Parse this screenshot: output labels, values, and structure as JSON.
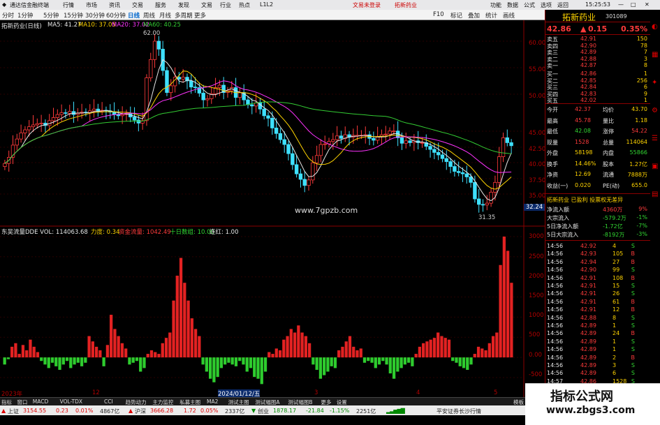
{
  "titlebar": {
    "app_name": "通达信金融终端",
    "menus": [
      "行情",
      "市场",
      "资讯",
      "交易",
      "服务",
      "发现",
      "文易",
      "行业",
      "热点",
      "L1L2"
    ],
    "right_items": [
      "文易未登录",
      "拓新药业"
    ],
    "controls": [
      "功能",
      "数据",
      "公式",
      "选项",
      "返回"
    ],
    "time": "15:25:53"
  },
  "toolbar": {
    "periods": [
      "分时",
      "1分钟",
      "5分钟",
      "15分钟",
      "30分钟",
      "60分钟",
      "日线",
      "周线",
      "月线",
      "多周期",
      "更多"
    ],
    "active": "日线",
    "right_labels": [
      "F10",
      "标记",
      "叠加",
      "统计",
      "画线"
    ]
  },
  "chart": {
    "title": "拓新药业(日线)",
    "ma_legend": [
      {
        "label": "MA5: 41.27",
        "color": "#e6e6e6"
      },
      {
        "label": "MA10: 37.05",
        "color": "#ffd400"
      },
      {
        "label": "MA20: 37.02",
        "color": "#ff33ff"
      },
      {
        "label": "MA60: 40.25",
        "color": "#33cc33"
      }
    ],
    "high_label": "62.00",
    "low_label": "31.35",
    "price_axis": [
      "60.00",
      "55.00",
      "50.00",
      "45.00",
      "42.50",
      "40.00",
      "37.50",
      "35.00"
    ],
    "crosshair_price": "32.24",
    "site": "www.7gpzb.com",
    "indicator_legend": [
      {
        "label": "东吴流量DDE  VOL: 114063.68",
        "color": "#e6e6e6"
      },
      {
        "label": "力度: 0.34",
        "color": "#ffd400"
      },
      {
        "label": "资金流量: 1042.49",
        "color": "#ff3b3b"
      },
      {
        "label": "十日数组: 10.00",
        "color": "#32d732"
      },
      {
        "label": "连红: 1.00",
        "color": "#e6e6e6"
      }
    ],
    "volume_axis": [
      "3000",
      "2500",
      "2000",
      "1500",
      "1000",
      "500",
      "0.00",
      "-500"
    ],
    "x_labels": [
      "2023年",
      "12",
      "2024/01/12/五",
      "3",
      "4",
      "5"
    ]
  },
  "quote": {
    "name": "拓新药业",
    "code": "301089",
    "price": "42.86",
    "change": "0.15",
    "change_pct": "0.35%",
    "asks": [
      {
        "label": "卖五",
        "price": "42.91",
        "vol": "150"
      },
      {
        "label": "卖四",
        "price": "42.90",
        "vol": "78"
      },
      {
        "label": "卖三",
        "price": "42.89",
        "vol": "7"
      },
      {
        "label": "卖二",
        "price": "42.88",
        "vol": "3"
      },
      {
        "label": "卖一",
        "price": "42.87",
        "vol": "8"
      }
    ],
    "bids": [
      {
        "label": "买一",
        "price": "42.86",
        "vol": "1"
      },
      {
        "label": "买二",
        "price": "42.85",
        "vol": "256"
      },
      {
        "label": "买三",
        "price": "42.84",
        "vol": "6"
      },
      {
        "label": "买四",
        "price": "42.83",
        "vol": "9"
      },
      {
        "label": "买五",
        "price": "42.02",
        "vol": "1"
      }
    ],
    "stats": [
      {
        "a": "今开",
        "av": "42.37",
        "b": "均价",
        "bv": "43.70"
      },
      {
        "a": "最高",
        "av": "45.78",
        "b": "量比",
        "bv": "1.18"
      },
      {
        "a": "最低",
        "av": "42.08",
        "b": "涨停",
        "bv": "54.22"
      },
      {
        "a": "现量",
        "av": "1528",
        "b": "总量",
        "bv": "114064"
      },
      {
        "a": "外盘",
        "av": "58198",
        "b": "内盘",
        "bv": "55866"
      },
      {
        "a": "换手",
        "av": "14.46%",
        "b": "股本",
        "bv": "1.27亿"
      },
      {
        "a": "净资",
        "av": "12.69",
        "b": "流通",
        "bv": "7888万"
      },
      {
        "a": "收益(一)",
        "av": "0.020",
        "b": "PE(动)",
        "bv": "655.0"
      }
    ],
    "fund_title": "拓新药业 已盈利 投票权无差异",
    "funds": [
      {
        "label": "净流入额",
        "val": "4360万",
        "pct": "9%"
      },
      {
        "label": "大宗流入",
        "val": "-579.2万",
        "pct": "-1%"
      },
      {
        "label": "5日净流入额",
        "val": "-1.72亿",
        "pct": "-7%"
      },
      {
        "label": "5日大宗流入",
        "val": "-8192万",
        "pct": "-3%"
      }
    ],
    "ticks": [
      {
        "t": "14:56",
        "p": "42.92",
        "v": "4",
        "s": "S"
      },
      {
        "t": "14:56",
        "p": "42.93",
        "v": "105",
        "s": "B"
      },
      {
        "t": "14:56",
        "p": "42.94",
        "v": "27",
        "s": "B"
      },
      {
        "t": "14:56",
        "p": "42.90",
        "v": "99",
        "s": "S"
      },
      {
        "t": "14:56",
        "p": "42.91",
        "v": "108",
        "s": "B"
      },
      {
        "t": "14:56",
        "p": "42.91",
        "v": "15",
        "s": "S"
      },
      {
        "t": "14:56",
        "p": "42.91",
        "v": "26",
        "s": "S"
      },
      {
        "t": "14:56",
        "p": "42.91",
        "v": "61",
        "s": "B"
      },
      {
        "t": "14:56",
        "p": "42.91",
        "v": "12",
        "s": "B"
      },
      {
        "t": "14:56",
        "p": "42.88",
        "v": "8",
        "s": "S"
      },
      {
        "t": "14:56",
        "p": "42.89",
        "v": "1",
        "s": "S"
      },
      {
        "t": "14:56",
        "p": "42.89",
        "v": "24",
        "s": "B"
      },
      {
        "t": "14:56",
        "p": "42.89",
        "v": "1",
        "s": "S"
      },
      {
        "t": "14:56",
        "p": "42.89",
        "v": "1",
        "s": "S"
      },
      {
        "t": "14:56",
        "p": "42.89",
        "v": "2",
        "s": "B"
      },
      {
        "t": "14:56",
        "p": "42.89",
        "v": "3",
        "s": "S"
      },
      {
        "t": "14:56",
        "p": "42.89",
        "v": "6",
        "s": "S"
      },
      {
        "t": "14:57",
        "p": "42.86",
        "v": "1528",
        "s": "S"
      }
    ]
  },
  "bottom_tabs": [
    "指标",
    "窗口",
    "MACD",
    "VOL-TDX",
    "CCI",
    "趋势动力",
    "主力监控",
    "私募主图",
    "MA2",
    "测试主图",
    "测试幅图A",
    "测试幅图B",
    "更多",
    "设置",
    "模板"
  ],
  "statusbar": [
    {
      "label": "上证",
      "v": "3154.55",
      "c": "0.23",
      "p": "0.01%",
      "amt": "4867亿"
    },
    {
      "label": "沪深",
      "v": "3666.28",
      "c": "1.72",
      "p": "0.05%",
      "amt": "2337亿"
    },
    {
      "label": "创业",
      "v": "1878.17",
      "c": "-21.84",
      "p": "-1.15%",
      "amt": "2251亿"
    }
  ],
  "status_right": "平安证券长沙行情",
  "status_left_extra": [
    "扩展^",
    "关联报价",
    "资金分布",
    "综合资讯",
    "行业资讯",
    "预约功能",
    "港股资讯"
  ],
  "watermark": {
    "title": "指标公式网",
    "url": "www.zbgs3.com"
  },
  "chart_data": {
    "type": "bar",
    "title": "东吴流量DDE",
    "series": [
      {
        "name": "资金流量",
        "values": [
          -20,
          -5,
          30,
          40,
          10,
          35,
          20,
          50,
          30,
          15,
          -10,
          -20,
          -30,
          -15,
          -25,
          -35,
          -20,
          -10,
          -30,
          -20,
          -15,
          -25,
          -15,
          60,
          45,
          30,
          20,
          -25,
          35,
          120,
          80,
          60,
          40,
          25,
          -20,
          -15,
          -10,
          -40,
          -30,
          10,
          20,
          15,
          10,
          40,
          55,
          70,
          160,
          230,
          280,
          210,
          160,
          110,
          80,
          60,
          -20,
          -40,
          -60,
          -70,
          -55,
          -30,
          -20,
          -15,
          -20,
          -25,
          -10,
          -20,
          -40,
          -30,
          -55,
          -60,
          -75,
          -40,
          15,
          10,
          25,
          20,
          50,
          60,
          80,
          70,
          90,
          70,
          60,
          40,
          -20,
          -35,
          -60,
          -50,
          -40,
          -25,
          -30,
          20,
          30,
          45,
          60,
          30,
          20,
          25,
          -15,
          -10,
          -15,
          -30,
          -20,
          -10,
          -20,
          -45,
          -60,
          -40,
          -30,
          -20,
          -15,
          -25,
          10,
          30,
          40,
          45,
          50,
          55,
          70,
          60,
          55,
          50,
          -10,
          -15,
          -25,
          -30,
          -35,
          -20,
          10,
          30,
          25,
          20,
          40,
          60,
          70,
          260,
          340,
          300,
          210
        ]
      }
    ]
  }
}
